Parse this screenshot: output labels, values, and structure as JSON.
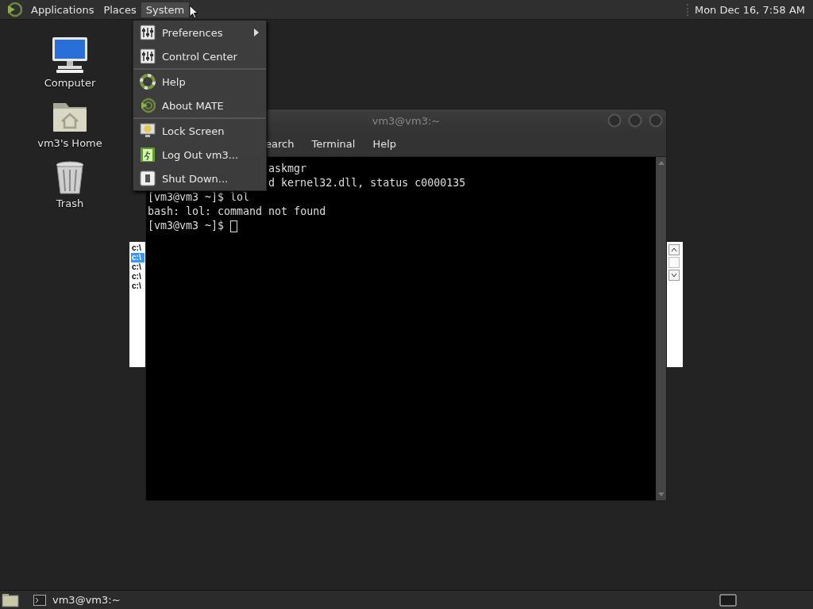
{
  "top_panel": {
    "menus": [
      {
        "label": "Applications",
        "selected": false
      },
      {
        "label": "Places",
        "selected": false
      },
      {
        "label": "System",
        "selected": true
      }
    ],
    "clock": "Mon Dec 16, 7:58 AM"
  },
  "desktop_icons": [
    {
      "label": "Computer",
      "kind": "computer"
    },
    {
      "label": "vm3's Home",
      "kind": "home"
    },
    {
      "label": "Trash",
      "kind": "trash"
    }
  ],
  "system_menu": {
    "groups": [
      {
        "items": [
          {
            "label": "Preferences",
            "kind": "preferences",
            "submenu": true
          },
          {
            "label": "Control Center",
            "kind": "preferences",
            "submenu": false
          }
        ]
      },
      {
        "items": [
          {
            "label": "Help",
            "kind": "help",
            "submenu": false
          },
          {
            "label": "About MATE",
            "kind": "about",
            "submenu": false
          }
        ]
      },
      {
        "items": [
          {
            "label": "Lock Screen",
            "kind": "lock",
            "submenu": false
          },
          {
            "label": "Log Out vm3...",
            "kind": "logout",
            "submenu": false
          },
          {
            "label": "Shut Down...",
            "kind": "shutdown",
            "submenu": false
          }
        ]
      }
    ]
  },
  "background_window": {
    "list": [
      {
        "label": "c:\\",
        "selected": false
      },
      {
        "label": "c:\\",
        "selected": true
      },
      {
        "label": "c:\\",
        "selected": false
      },
      {
        "label": "c:\\",
        "selected": false
      },
      {
        "label": "c:\\",
        "selected": false
      }
    ]
  },
  "terminal": {
    "title": "vm3@vm3:~",
    "menus": [
      "earch",
      "Terminal",
      "Help"
    ],
    "lines": [
      {
        "text": "askmgr",
        "kind": "partial"
      },
      {
        "text": "d kernel32.dll, status c0000135",
        "kind": "partial"
      },
      {
        "text": "[vm3@vm3 ~]$ lol",
        "kind": "full"
      },
      {
        "text": "bash: lol: command not found",
        "kind": "full"
      },
      {
        "text": "[vm3@vm3 ~]$ ",
        "kind": "prompt"
      }
    ]
  },
  "taskbar": {
    "tasks": [
      {
        "label": "vm3@vm3:~",
        "selected": false
      }
    ]
  }
}
